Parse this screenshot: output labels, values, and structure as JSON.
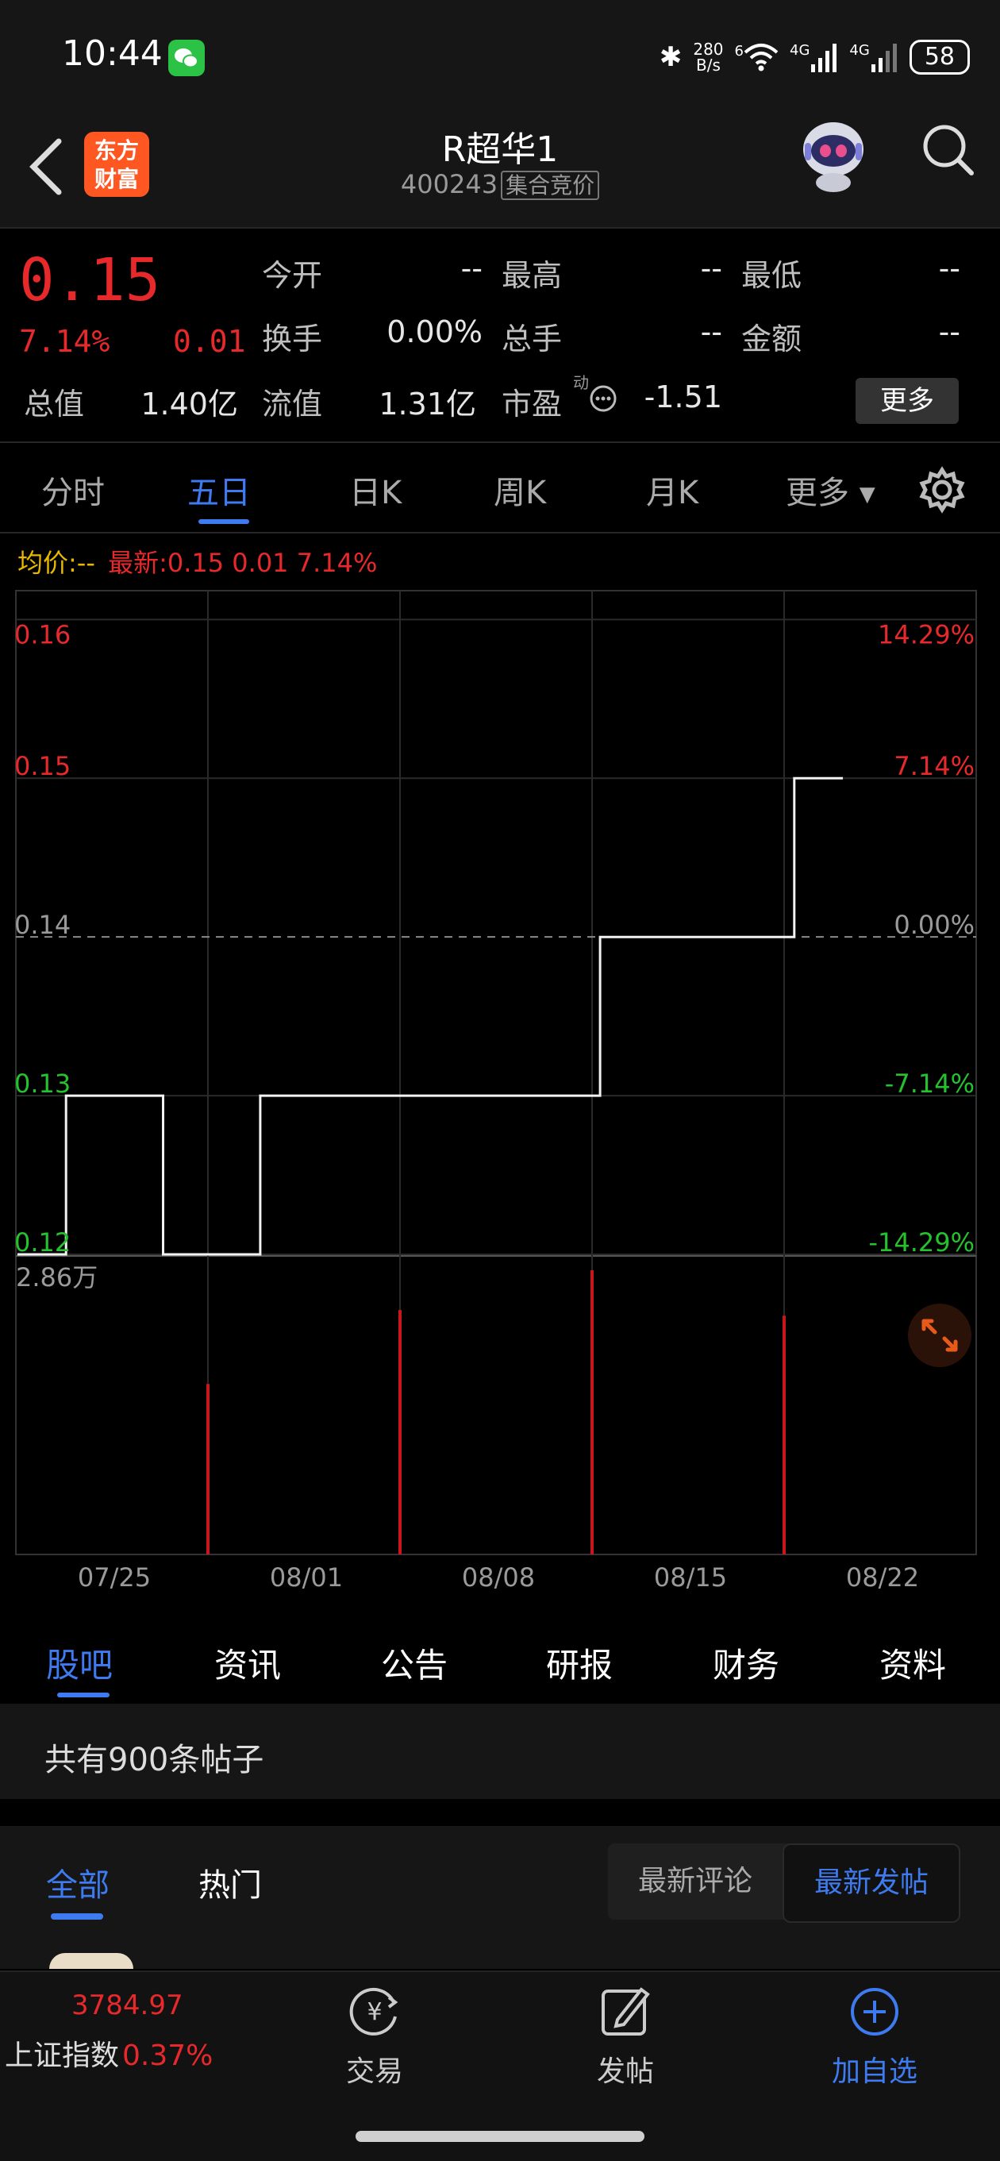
{
  "status": {
    "time": "10:44",
    "net_speed_value": "280",
    "net_speed_unit": "B/s",
    "wifi_badge": "6",
    "signal1": "4G",
    "signal2": "4G",
    "battery": "58"
  },
  "header": {
    "logo_line1": "东方",
    "logo_line2": "财富",
    "title": "R超华1",
    "code": "400243",
    "tag": "集合竞价"
  },
  "quote": {
    "price": "0.15",
    "change_pct": "7.14%",
    "change_amt": "0.01",
    "rows": [
      {
        "label": "今开",
        "value": "--",
        "label2": "最高",
        "value2": "--",
        "label3": "最低",
        "value3": "--"
      },
      {
        "label": "换手",
        "value": "0.00%",
        "label2": "总手",
        "value2": "--",
        "label3": "金额",
        "value3": "--"
      }
    ],
    "total_cap_label": "总值",
    "total_cap": "1.40亿",
    "float_cap_label": "流值",
    "float_cap": "1.31亿",
    "pe_label": "市盈",
    "pe_sup": "动",
    "pe_value": "-1.51",
    "more_label": "更多"
  },
  "chart_tabs": [
    "分时",
    "五日",
    "日K",
    "周K",
    "月K",
    "更多"
  ],
  "chart_tab_active": 1,
  "legend": {
    "avg_label": "均价:",
    "avg_value": "--",
    "latest_label": "最新:",
    "latest_value": "0.15 0.01 7.14%"
  },
  "chart_data": {
    "type": "line",
    "x_ticks": [
      "07/25",
      "08/01",
      "08/08",
      "08/15",
      "08/22"
    ],
    "y_ticks": [
      "0.16",
      "0.15",
      "0.14",
      "0.13",
      "0.12"
    ],
    "y_pct_ticks": [
      "14.29%",
      "7.14%",
      "0.00%",
      "-7.14%",
      "-14.29%"
    ],
    "ylim": [
      0.12,
      0.16
    ],
    "prev_close": 0.14,
    "volume_label": "2.86万",
    "series": [
      {
        "values": [
          0.12,
          0.13,
          0.13,
          0.12,
          0.12,
          0.13,
          0.13,
          0.13,
          0.13,
          0.13,
          0.13,
          0.13,
          0.14,
          0.14,
          0.14,
          0.14,
          0.15
        ]
      }
    ]
  },
  "content_tabs": [
    "股吧",
    "资讯",
    "公告",
    "研报",
    "财务",
    "资料"
  ],
  "content_tab_active": 0,
  "posts": {
    "count_text": "共有900条帖子"
  },
  "filters": {
    "all": "全部",
    "hot": "热门",
    "latest_comment": "最新评论",
    "latest_post": "最新发帖"
  },
  "bottom_nav": {
    "index_value": "3784.97",
    "index_name": "上证指数",
    "index_change": "0.37%",
    "trade": "交易",
    "post": "发帖",
    "add_watch": "加自选"
  }
}
